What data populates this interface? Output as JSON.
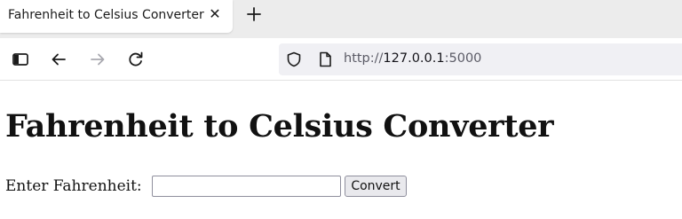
{
  "browser": {
    "tab": {
      "title": "Fahrenheit to Celsius Converter",
      "close_glyph": "✕"
    },
    "url": {
      "scheme": "http://",
      "host": "127.0.0.1",
      "port": ":5000"
    },
    "icons": {
      "sidebar": "sidebar-icon",
      "back": "arrow-left-icon",
      "forward": "arrow-right-icon",
      "reload": "reload-icon",
      "shield": "shield-icon",
      "page": "page-icon",
      "new_tab": "plus-icon"
    }
  },
  "page": {
    "title": "Fahrenheit to Celsius Converter",
    "form": {
      "label": "Enter Fahrenheit:",
      "input_value": "",
      "button_label": "Convert"
    }
  }
}
